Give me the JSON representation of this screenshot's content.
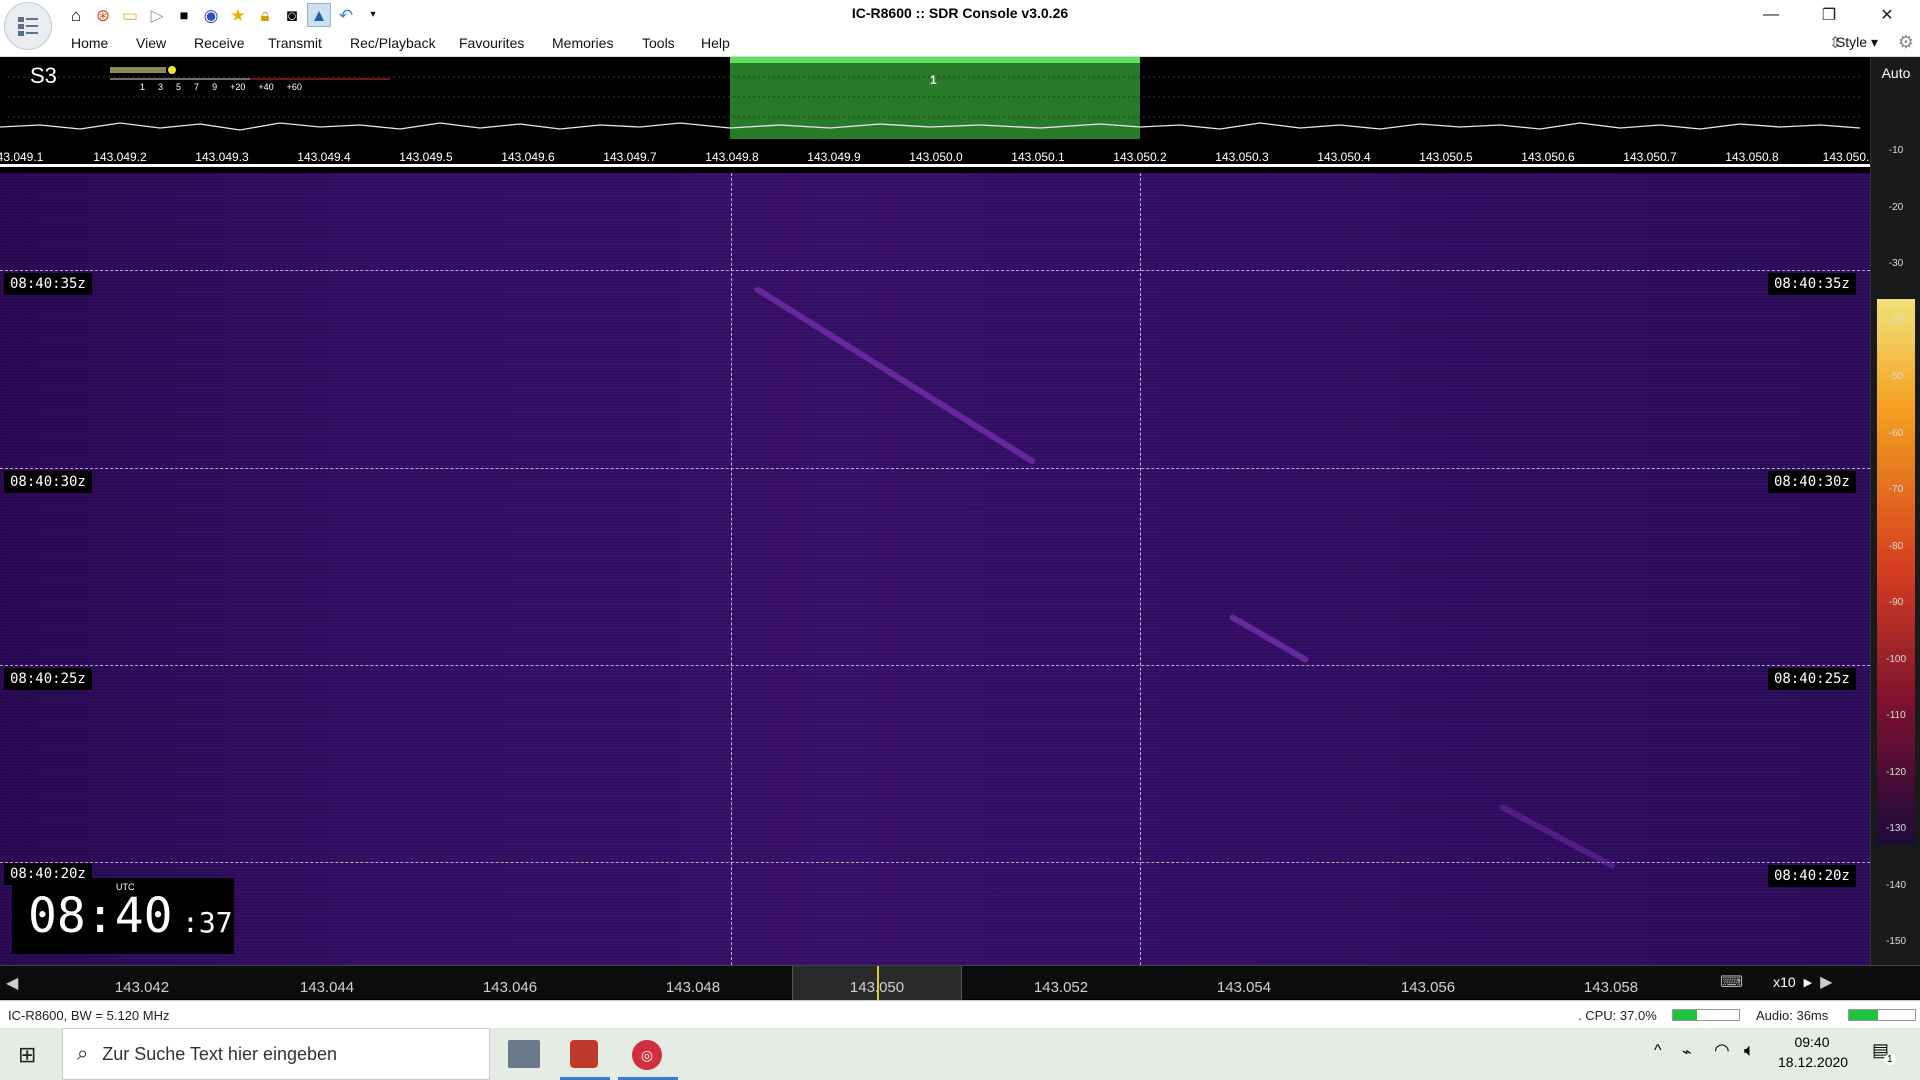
{
  "window": {
    "title": "IC-R8600 :: SDR Console v3.0.26"
  },
  "qat_icons": [
    "home-icon",
    "lifebuoy-icon",
    "folder-icon",
    "play-icon",
    "stop-icon",
    "record-icon",
    "star-icon",
    "lock-icon",
    "camera-icon",
    "bookmark-icon",
    "undo-icon",
    "qat-dropdown-icon"
  ],
  "menu": {
    "items": [
      "Home",
      "View",
      "Receive",
      "Transmit",
      "Rec/Playback",
      "Favourites",
      "Memories",
      "Tools",
      "Help"
    ],
    "style_label": "Style"
  },
  "spectrum": {
    "smeter": "S3",
    "meter_scale": [
      "1",
      "3",
      "5",
      "7",
      "9",
      "+20",
      "+40",
      "+60"
    ],
    "channel_label": "1",
    "freq_ticks": [
      "43.049.1",
      "143.049.2",
      "143.049.3",
      "143.049.4",
      "143.049.5",
      "143.049.6",
      "143.049.7",
      "143.049.8",
      "143.049.9",
      "143.050.0",
      "143.050.1",
      "143.050.2",
      "143.050.3",
      "143.050.4",
      "143.050.5",
      "143.050.6",
      "143.050.7",
      "143.050.8",
      "143.050."
    ]
  },
  "waterfall": {
    "times": [
      "08:40:35z",
      "08:40:30z",
      "08:40:25z",
      "08:40:20z"
    ]
  },
  "clock": {
    "label": "UTC",
    "hm": "08:40",
    "sec": ":37"
  },
  "dbscale": {
    "auto_label": "Auto",
    "ticks": [
      "-10",
      "-20",
      "-30",
      "-40",
      "-50",
      "-60",
      "-70",
      "-80",
      "-90",
      "-100",
      "-110",
      "-120",
      "-130",
      "-140",
      "-150"
    ]
  },
  "bottom_scale": {
    "freqs": [
      "143.042",
      "143.044",
      "143.046",
      "143.048",
      "143.050",
      "143.052",
      "143.054",
      "143.056",
      "143.058"
    ],
    "zoom": "x10"
  },
  "status": {
    "left": "IC-R8600, BW = 5.120 MHz",
    "cpu": ". CPU: 37.0%",
    "cpu_level": 0.37,
    "audio": "Audio: 36ms"
  },
  "taskbar": {
    "search_placeholder": "Zur Suche Text hier eingeben",
    "time": "09:40",
    "date": "18.12.2020",
    "notif_count": "1"
  }
}
